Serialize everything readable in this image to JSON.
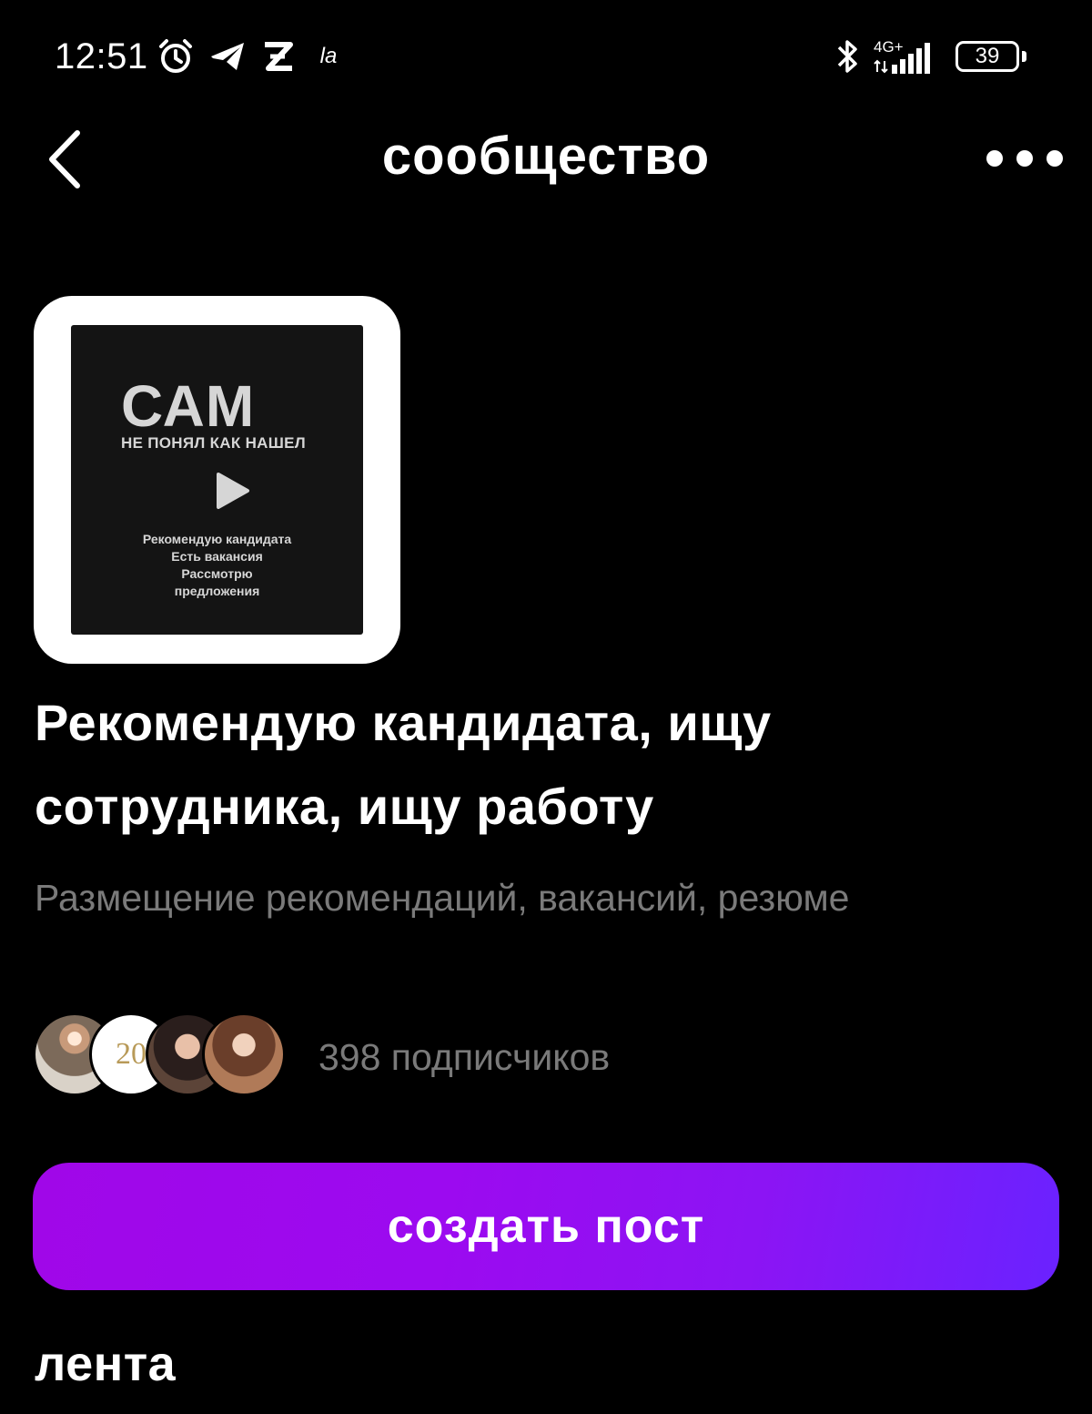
{
  "status_bar": {
    "time": "12:51",
    "la_label": "la",
    "network_label": "4G+",
    "battery": "39",
    "icons": [
      "alarm-icon",
      "telegram-icon",
      "z-icon",
      "la-icon",
      "bluetooth-icon",
      "signal-icon",
      "battery-icon"
    ]
  },
  "header": {
    "title": "сообщество",
    "back_icon": "chevron-left-icon",
    "more_icon": "more-horizontal-icon"
  },
  "community": {
    "cover": {
      "big_text": "САМ",
      "sub_text": "НЕ ПОНЯЛ КАК НАШЕЛ",
      "lines": [
        "Рекомендую кандидата",
        "Есть вакансия",
        "Рассмотрю",
        "предложения"
      ]
    },
    "name_line1": "Рекомендую кандидата, ищу",
    "name_line2": "сотрудника, ищу работу",
    "description": "Размещение рекомендаций, вакансий, резюме",
    "subscribers": "398 подписчиков",
    "subscriber_avatar_2_text": "20"
  },
  "actions": {
    "create_post": "создать пост"
  },
  "feed": {
    "title": "лента"
  },
  "colors": {
    "background": "#000000",
    "text_primary": "#ffffff",
    "text_secondary": "#7a7a7a",
    "button_gradient_start": "#a007e8",
    "button_gradient_end": "#6a22ff"
  }
}
